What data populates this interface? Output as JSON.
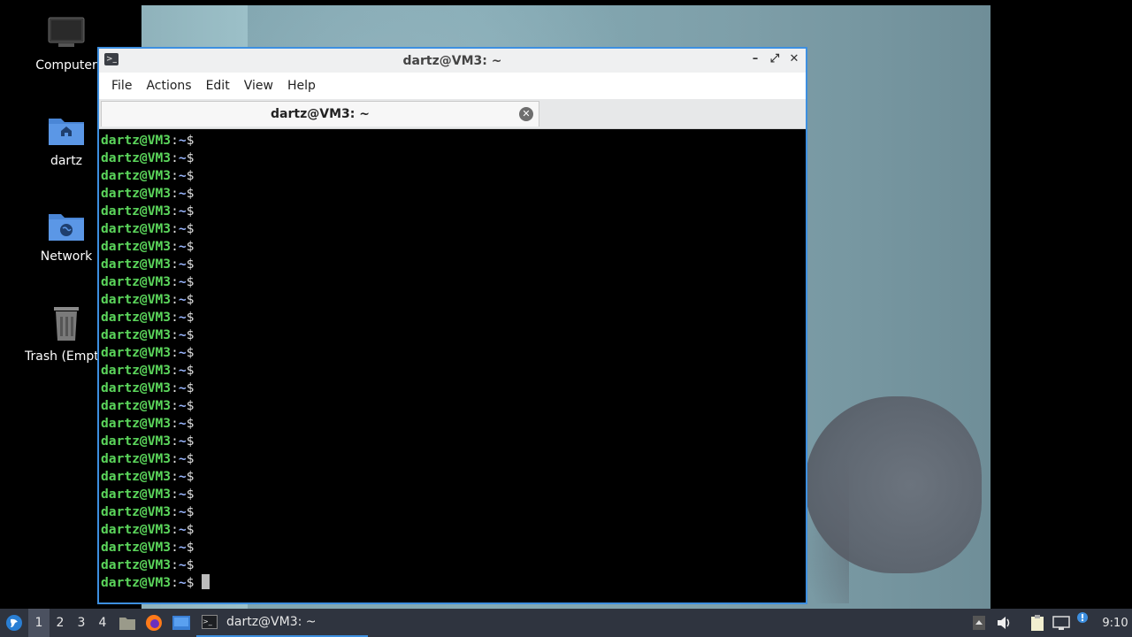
{
  "desktop": {
    "icons": [
      {
        "label": "Computer",
        "icon": "computer-icon"
      },
      {
        "label": "dartz",
        "icon": "home-folder-icon"
      },
      {
        "label": "Network",
        "icon": "network-folder-icon"
      },
      {
        "label": "Trash (Empty)",
        "icon": "trash-icon"
      }
    ]
  },
  "window": {
    "title": "dartz@VM3: ~",
    "controls": {
      "minimize": "–",
      "maximize": "⤢",
      "close": "✕"
    },
    "menu": [
      "File",
      "Actions",
      "Edit",
      "View",
      "Help"
    ],
    "tab": {
      "label": "dartz@VM3: ~",
      "close": "✕"
    }
  },
  "terminal": {
    "prompt_user": "dartz@VM3",
    "prompt_sep": ":",
    "prompt_path": "~",
    "prompt_symbol": "$",
    "line_count": 26
  },
  "taskbar": {
    "workspaces": [
      "1",
      "2",
      "3",
      "4"
    ],
    "active_workspace": "1",
    "task": {
      "label": "dartz@VM3: ~"
    },
    "clock": "9:10",
    "colors": {
      "accent": "#3d8fe0",
      "panel": "#2f343f"
    }
  },
  "colors": {
    "prompt_user": "#5bd55b",
    "prompt_path": "#9ab7ff",
    "window_border": "#3d8fe0"
  }
}
